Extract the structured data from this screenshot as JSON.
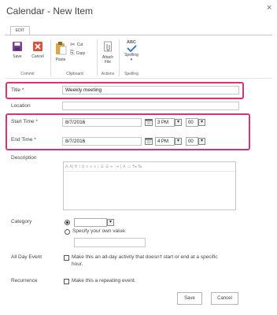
{
  "dialog": {
    "title": "Calendar - New Item",
    "close_glyph": "×"
  },
  "ribbon": {
    "tab": "EDIT",
    "buttons": {
      "save": "Save",
      "cancel": "Cancel",
      "paste": "Paste",
      "cut": "Cut",
      "copy": "Copy",
      "attach_line1": "Attach",
      "attach_line2": "File",
      "spelling_badge": "ABC",
      "spelling": "Spelling"
    },
    "groups": {
      "commit": "Commit",
      "clipboard": "Clipboard",
      "actions": "Actions",
      "spelling": "Spelling"
    }
  },
  "form": {
    "title_label": "Title *",
    "title_value": "Weekly meeting",
    "location_label": "Location",
    "location_value": "",
    "start_label": "Start Time *",
    "start_date": "8/7/2016",
    "start_hour": "3 PM",
    "start_min": "00",
    "end_label": "End Time *",
    "end_date": "8/7/2016",
    "end_hour": "4 PM",
    "end_min": "00",
    "description_label": "Description",
    "category_label": "Category",
    "category_specify": "Specify your own value:",
    "allday_label": "All Day Event",
    "allday_text_1": "Make this an all-day activity that doesn't start or end at a specific",
    "allday_text_2": "hour.",
    "recurrence_label": "Recurrence",
    "recurrence_text": "Make this a repeating event."
  },
  "rte_toolbar": [
    "A",
    "A|",
    "B",
    "I",
    "U",
    "≡",
    "≡",
    "≡",
    "|",
    "☰",
    "☰",
    "⇤",
    "⇥",
    "|",
    "A",
    "▭",
    "¶◂",
    "¶▸"
  ],
  "actions": {
    "save": "Save",
    "cancel": "Cancel"
  },
  "colors": {
    "highlight": "#d4347a",
    "save_icon": "#7a3e92",
    "cancel_icon": "#d9533a",
    "spelling_check": "#3b7ec2"
  }
}
